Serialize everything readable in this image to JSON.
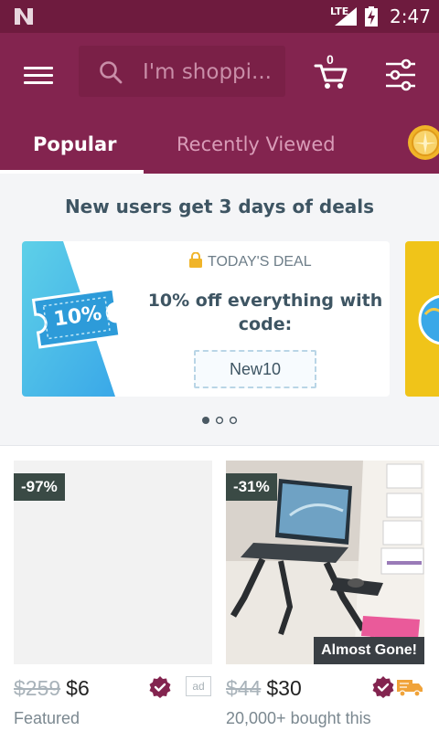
{
  "status_bar": {
    "network": "LTE",
    "time": "2:47"
  },
  "search": {
    "placeholder": "I'm shoppi..."
  },
  "cart": {
    "count": "0"
  },
  "tabs": [
    {
      "label": "Popular",
      "selected": true
    },
    {
      "label": "Recently Viewed",
      "selected": false
    }
  ],
  "promo": {
    "title": "New users get 3 days of deals",
    "card": {
      "badge_text": "10%",
      "header": "TODAY'S DEAL",
      "description": "10% off everything with code:",
      "code": "New10"
    },
    "pager": {
      "total": 3,
      "active": 0
    }
  },
  "products": [
    {
      "discount": "-97%",
      "old_price": "$259",
      "new_price": "$6",
      "subtext": "Featured",
      "ad_label": "ad",
      "thumb": "blank"
    },
    {
      "discount": "-31%",
      "old_price": "$44",
      "new_price": "$30",
      "subtext": "20,000+ bought this",
      "stock_label": "Almost Gone!",
      "thumb": "laptop-stand"
    }
  ],
  "colors": {
    "status_bar": "#6e1b3e",
    "app_bar": "#83244f",
    "accent": "#83244f",
    "deal_ticket": "#3fa9e0",
    "truck": "#f0a33a"
  }
}
